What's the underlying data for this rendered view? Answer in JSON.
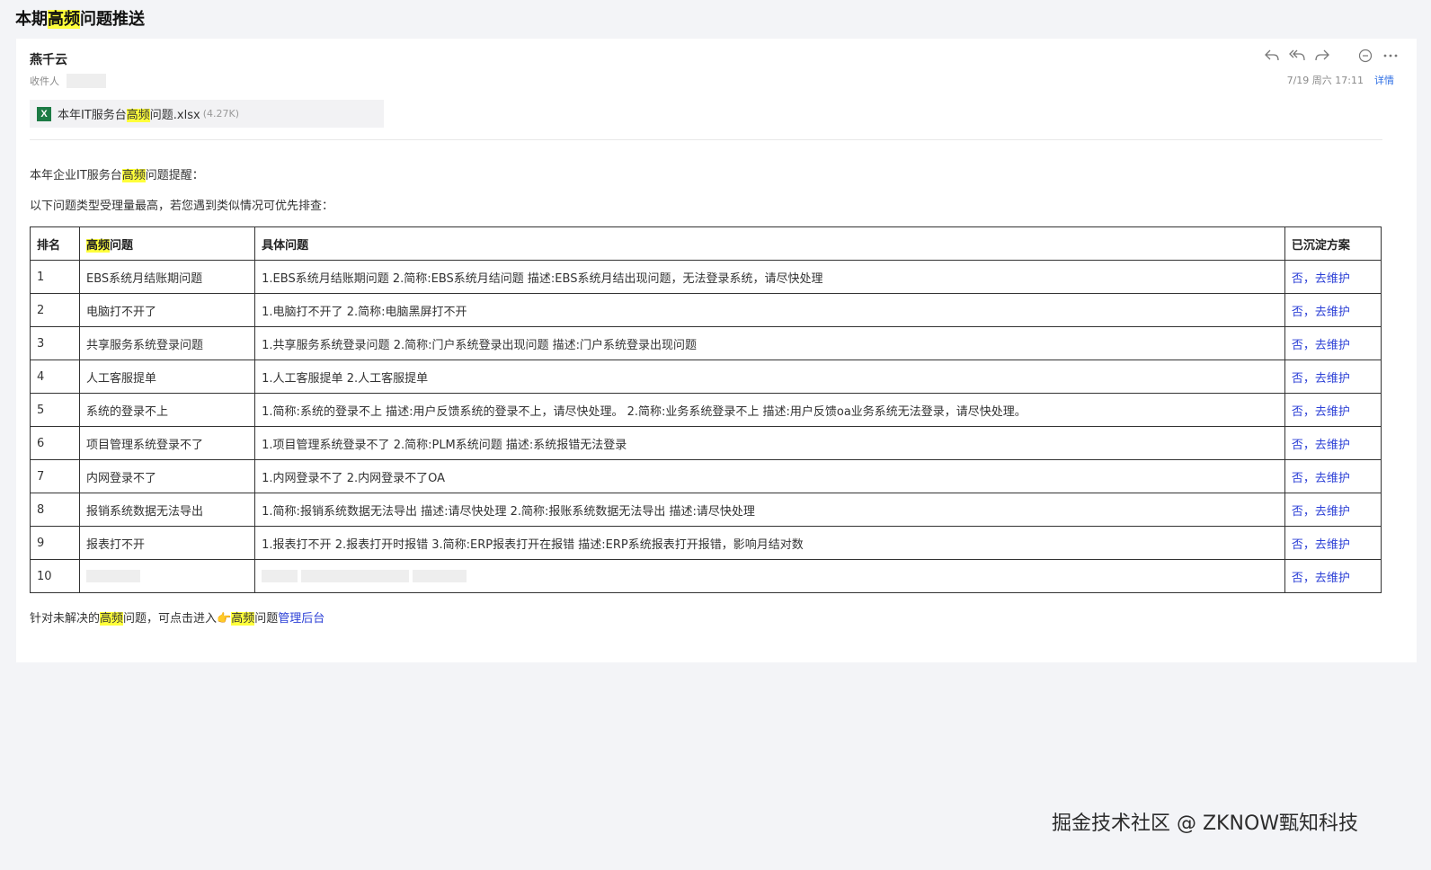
{
  "title": {
    "prefix": "本期",
    "highlight": "高频",
    "suffix": "问题推送"
  },
  "email": {
    "sender": "燕千云",
    "recipient_label": "收件人",
    "date": "7/19 周六 17:11",
    "detail_label": "详情",
    "toolbar_icons": [
      "reply-icon",
      "reply-all-icon",
      "forward-icon",
      "comment-icon",
      "more-icon"
    ],
    "attachment": {
      "icon_letter": "X",
      "name_prefix": "本年IT服务台",
      "name_highlight": "高频",
      "name_suffix": "问题.xlsx",
      "size": "(4.27K)"
    }
  },
  "body": {
    "intro1_prefix": "本年企业IT服务台",
    "intro1_highlight": "高频",
    "intro1_suffix": "问题提醒：",
    "intro2": "以下问题类型受理量最高，若您遇到类似情况可优先排查："
  },
  "table": {
    "headers": {
      "rank": "排名",
      "category_highlight": "高频",
      "category_suffix": "问题",
      "details": "具体问题",
      "solution": "已沉淀方案"
    },
    "rows": [
      {
        "rank": "1",
        "category": "EBS系统月结账期问题",
        "details": "1.EBS系统月结账期问题 2.简称:EBS系统月结问题 描述:EBS系统月结出现问题，无法登录系统，请尽快处理",
        "solution": "否，去维护"
      },
      {
        "rank": "2",
        "category": "电脑打不开了",
        "details": "1.电脑打不开了 2.简称:电脑黑屏打不开",
        "solution": "否，去维护"
      },
      {
        "rank": "3",
        "category": "共享服务系统登录问题",
        "details": "1.共享服务系统登录问题 2.简称:门户系统登录出现问题 描述:门户系统登录出现问题",
        "solution": "否，去维护"
      },
      {
        "rank": "4",
        "category": "人工客服提单",
        "details": "1.人工客服提单 2.人工客服提单",
        "solution": "否，去维护"
      },
      {
        "rank": "5",
        "category": "系统的登录不上",
        "details": "1.简称:系统的登录不上 描述:用户反馈系统的登录不上，请尽快处理。 2.简称:业务系统登录不上 描述:用户反馈oa业务系统无法登录，请尽快处理。",
        "solution": "否，去维护"
      },
      {
        "rank": "6",
        "category": "项目管理系统登录不了",
        "details": "1.项目管理系统登录不了 2.简称:PLM系统问题 描述:系统报错无法登录",
        "solution": "否，去维护"
      },
      {
        "rank": "7",
        "category": "内网登录不了",
        "details": "1.内网登录不了 2.内网登录不了OA",
        "solution": "否，去维护"
      },
      {
        "rank": "8",
        "category": "报销系统数据无法导出",
        "details": "1.简称:报销系统数据无法导出 描述:请尽快处理 2.简称:报账系统数据无法导出 描述:请尽快处理",
        "solution": "否，去维护"
      },
      {
        "rank": "9",
        "category": "报表打不开",
        "details": "1.报表打不开 2.报表打开时报错 3.简称:ERP报表打开在报错 描述:ERP系统报表打开报错，影响月结对数",
        "solution": "否，去维护"
      },
      {
        "rank": "10",
        "category": "",
        "details": "",
        "solution": "否，去维护"
      }
    ]
  },
  "footer": {
    "prefix": "针对未解决的",
    "highlight1": "高频",
    "middle": "问题，可点击进入",
    "pointer": "👉",
    "highlight2": "高频",
    "suffix": "问题",
    "link": "管理后台"
  },
  "watermark": "掘金技术社区 @ ZKNOW甄知科技",
  "colors": {
    "highlight": "#ffff3b",
    "link": "#2b3fd6",
    "excel_green": "#1d7b45"
  }
}
